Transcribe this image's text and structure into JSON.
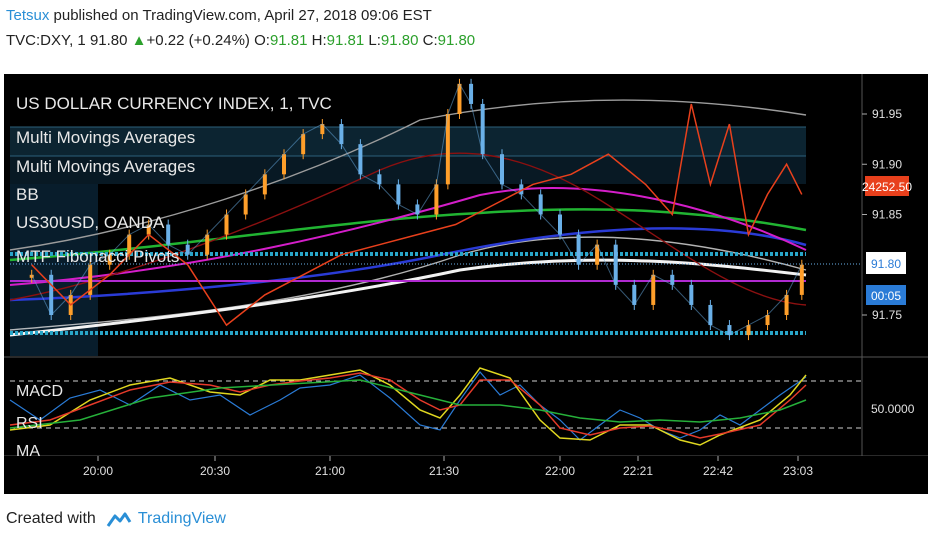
{
  "header": {
    "author": "Tetsux",
    "published_text": "published on TradingView.com, April 27, 2018 09:06 EST",
    "symbol": "TVC:DXY, 1",
    "last": "91.80",
    "arrow": "▲",
    "change": "+0.22 (+0.24%)",
    "o_label": "O:",
    "o_val": "91.81",
    "h_label": "H:",
    "h_val": "91.81",
    "l_label": "L:",
    "l_val": "91.80",
    "c_label": "C:",
    "c_val": "91.80"
  },
  "legend": {
    "items": [
      "US DOLLAR CURRENCY INDEX, 1, TVC",
      "Multi Movings Averages",
      "Multi Movings Averages",
      "BB",
      "US30USD, OANDA",
      "MTF Fibonacci Pivots"
    ],
    "lower_items": [
      "MACD",
      "RSI",
      "MA"
    ]
  },
  "price_axis": {
    "ticks": [
      "91.95",
      "91.90",
      "91.85",
      "91.75"
    ],
    "current_price": "91.80",
    "countdown": "00:05",
    "us30_label": "24252.50",
    "lower_tick": "50.0000"
  },
  "time_axis": {
    "ticks": [
      "20:00",
      "20:30",
      "21:00",
      "21:30",
      "22:00",
      "22:21",
      "22:42",
      "23:03"
    ]
  },
  "colors": {
    "background": "#000000",
    "up_candle": "#ff9f2a",
    "down_candle": "#6ab0e8",
    "us30": "#e8401c",
    "pivot": "#29a6c9",
    "countdown_bg": "#2a7bd6",
    "us30_label_bg": "#e8401c"
  },
  "footer": {
    "created_with": "Created with",
    "brand": "TradingView"
  },
  "chart_data": {
    "type": "line",
    "title": "US DOLLAR CURRENCY INDEX, 1, TVC",
    "x_ticks": [
      "20:00",
      "20:30",
      "21:00",
      "21:30",
      "22:00",
      "22:21",
      "22:42",
      "23:03"
    ],
    "ylim": [
      91.72,
      91.99
    ],
    "y_ticks": [
      91.75,
      91.85,
      91.9,
      91.95
    ],
    "series": [
      {
        "name": "US DOLLAR CURRENCY INDEX, 1, TVC",
        "x": [
          "19:43",
          "19:48",
          "19:53",
          "19:58",
          "20:03",
          "20:08",
          "20:13",
          "20:18",
          "20:23",
          "20:28",
          "20:33",
          "20:38",
          "20:43",
          "20:48",
          "20:53",
          "20:58",
          "21:03",
          "21:08",
          "21:13",
          "21:18",
          "21:23",
          "21:28",
          "21:31",
          "21:34",
          "21:37",
          "21:40",
          "21:45",
          "21:50",
          "21:55",
          "22:00",
          "22:05",
          "22:10",
          "22:15",
          "22:20",
          "22:25",
          "22:30",
          "22:35",
          "22:40",
          "22:45",
          "22:50",
          "22:55",
          "23:00",
          "23:04"
        ],
        "values": [
          91.79,
          91.75,
          91.77,
          91.8,
          91.81,
          91.83,
          91.84,
          91.82,
          91.81,
          91.83,
          91.85,
          91.87,
          91.89,
          91.91,
          91.93,
          91.94,
          91.92,
          91.89,
          91.88,
          91.86,
          91.85,
          91.88,
          91.95,
          91.98,
          91.96,
          91.91,
          91.88,
          91.87,
          91.85,
          91.83,
          91.8,
          91.82,
          91.78,
          91.76,
          91.79,
          91.78,
          91.76,
          91.74,
          91.73,
          91.74,
          91.75,
          91.77,
          91.8
        ]
      },
      {
        "name": "US30USD, OANDA",
        "x": [
          "19:43",
          "19:53",
          "20:03",
          "20:13",
          "20:23",
          "20:33",
          "20:43",
          "20:53",
          "21:03",
          "21:13",
          "21:23",
          "21:33",
          "21:43",
          "21:53",
          "22:03",
          "22:13",
          "22:23",
          "22:30",
          "22:35",
          "22:40",
          "22:45",
          "22:50",
          "22:55",
          "23:00",
          "23:04"
        ],
        "values": [
          91.8,
          91.76,
          91.79,
          91.83,
          91.8,
          91.74,
          91.77,
          91.79,
          91.81,
          91.82,
          91.83,
          91.84,
          91.86,
          91.88,
          91.89,
          91.91,
          91.88,
          91.85,
          91.96,
          91.88,
          91.94,
          91.83,
          91.87,
          91.9,
          91.87
        ]
      }
    ]
  }
}
